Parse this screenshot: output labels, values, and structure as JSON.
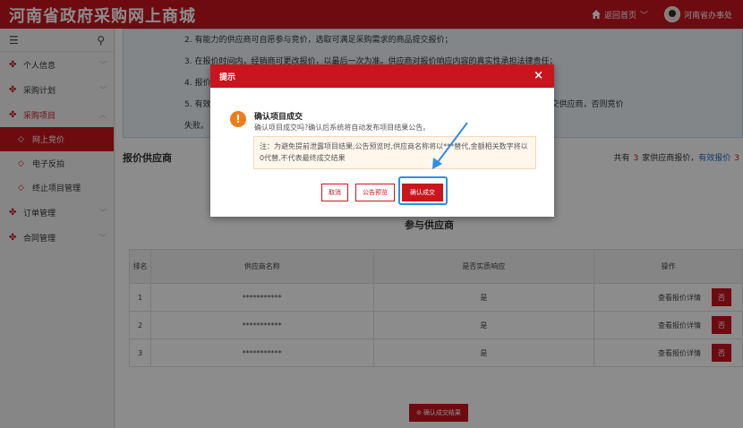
{
  "header": {
    "brand": "河南省政府采购网上商城",
    "home_label": "返回首页",
    "user_label": "河南省办事处"
  },
  "sidebar": {
    "items": [
      {
        "label": "个人信息"
      },
      {
        "label": "采购计划"
      },
      {
        "label": "采购项目"
      },
      {
        "label": "订单管理"
      },
      {
        "label": "合同管理"
      }
    ],
    "sub_items": [
      {
        "label": "网上竞价"
      },
      {
        "label": "电子反拍"
      },
      {
        "label": "终止项目管理"
      }
    ]
  },
  "notice": {
    "lines": [
      "2. 有能力的供应商可自愿参与竞价，选取可满足采购需求的商品提交报价；",
      "3. 在报价时间内，经销商可更改报价，以最后一次为准。供应商对报价响应内容的真实性承担法律责任；",
      "4. 报价",
      "5. 有效",
      "失败。"
    ],
    "line5_tail": "交供应商，否则竞价"
  },
  "bid": {
    "title": "报价供应商",
    "stats_prefix": "共有",
    "stats_count": "3",
    "stats_middle": "家供应商报价，",
    "stats_link": "有效报价",
    "stats_valid": "3"
  },
  "supplier_section": {
    "title": "参与供应商",
    "columns": [
      "排名",
      "供应商名称",
      "是否实质响应",
      "操作"
    ],
    "rows": [
      {
        "rank": "1",
        "name": "***********",
        "response": "是",
        "action": "查看报价详情",
        "flag": "否"
      },
      {
        "rank": "2",
        "name": "***********",
        "response": "是",
        "action": "查看报价详情",
        "flag": "否"
      },
      {
        "rank": "3",
        "name": "***********",
        "response": "是",
        "action": "查看报价详情",
        "flag": "否"
      }
    ],
    "confirm_button": "确认成交结果"
  },
  "modal": {
    "header": "提示",
    "title": "确认项目成交",
    "desc": "确认项目成交吗?确认后系统将自动发布项目结果公告。",
    "note": "注：为避免提前泄露项目结果,公告预览时,供应商名称将以***替代,金额相关数字将以0代替,不代表最终成交结果",
    "buttons": {
      "cancel": "取消",
      "preview": "公告预览",
      "confirm": "确认成交"
    }
  },
  "colors": {
    "brand_red": "#c9151e",
    "warning_orange": "#f07b1a",
    "highlight_blue": "#2d8ee8"
  }
}
